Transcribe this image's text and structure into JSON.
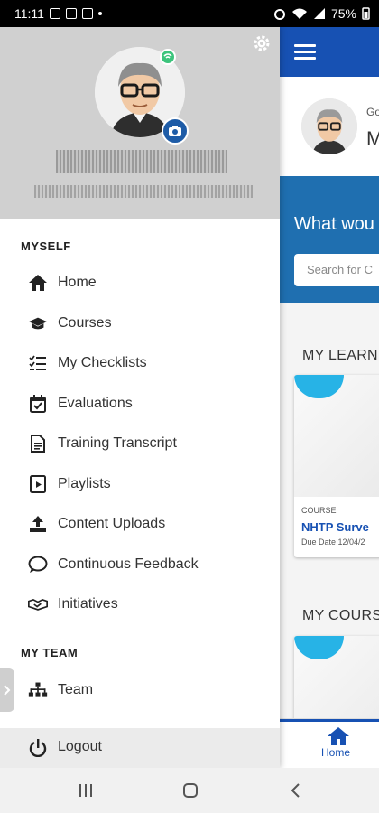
{
  "status_bar": {
    "time": "11:11",
    "battery": "75%"
  },
  "drawer": {
    "sections": [
      {
        "title": "MYSELF",
        "items": [
          {
            "label": "Home",
            "icon": "home-icon"
          },
          {
            "label": "Courses",
            "icon": "graduation-cap-icon"
          },
          {
            "label": "My Checklists",
            "icon": "checklist-icon"
          },
          {
            "label": "Evaluations",
            "icon": "calendar-check-icon"
          },
          {
            "label": "Training Transcript",
            "icon": "document-icon"
          },
          {
            "label": "Playlists",
            "icon": "playlist-icon"
          },
          {
            "label": "Content Uploads",
            "icon": "upload-icon"
          },
          {
            "label": "Continuous Feedback",
            "icon": "chat-bubble-icon"
          },
          {
            "label": "Initiatives",
            "icon": "handshake-icon"
          }
        ]
      },
      {
        "title": "MY TEAM",
        "items": [
          {
            "label": "Team",
            "icon": "org-chart-icon"
          }
        ]
      }
    ],
    "logout_label": "Logout"
  },
  "background": {
    "greeting": "Go",
    "name_initial": "M",
    "hero_text": "What wou",
    "search_placeholder": "Search for C",
    "section_learning": "MY LEARNI",
    "section_courses": "MY COURSE",
    "card": {
      "type": "COURSE",
      "title": "NHTP Surve",
      "due": "Due Date 12/04/2"
    },
    "bottom_nav_home": "Home"
  },
  "colors": {
    "brand_blue": "#1751b3",
    "hero_blue": "#1f6fb0",
    "accent_cyan": "#27b3e6",
    "drawer_header": "#d0d0d0"
  }
}
